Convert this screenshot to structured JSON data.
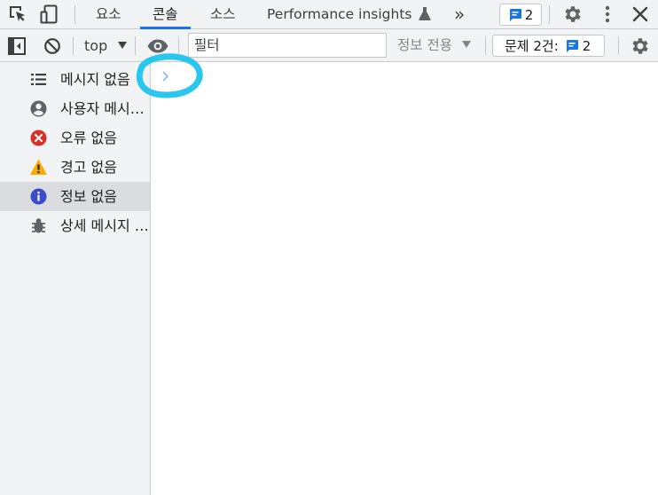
{
  "tabs": [
    {
      "label": "요소",
      "active": false
    },
    {
      "label": "콘솔",
      "active": true
    },
    {
      "label": "소스",
      "active": false
    },
    {
      "label": "Performance insights",
      "active": false
    }
  ],
  "issues_badge_count": "2",
  "toolbar": {
    "context": "top",
    "filter_placeholder": "필터",
    "levels_label": "정보 전용",
    "issues_label": "문제 2건:",
    "issues_count": "2"
  },
  "sidebar": {
    "items": [
      {
        "label": "메시지 없음",
        "icon": "list-icon"
      },
      {
        "label": "사용자 메시지 없음",
        "icon": "user-icon"
      },
      {
        "label": "오류 없음",
        "icon": "error-icon"
      },
      {
        "label": "경고 없음",
        "icon": "warning-icon"
      },
      {
        "label": "정보 없음",
        "icon": "info-icon",
        "selected": true
      },
      {
        "label": "상세 메시지 없음",
        "icon": "bug-icon"
      }
    ]
  },
  "colors": {
    "accent": "#1a73e8",
    "error": "#d93025",
    "warning": "#f9ab00",
    "info": "#3c4cc9",
    "annotation": "#29c6f0"
  }
}
